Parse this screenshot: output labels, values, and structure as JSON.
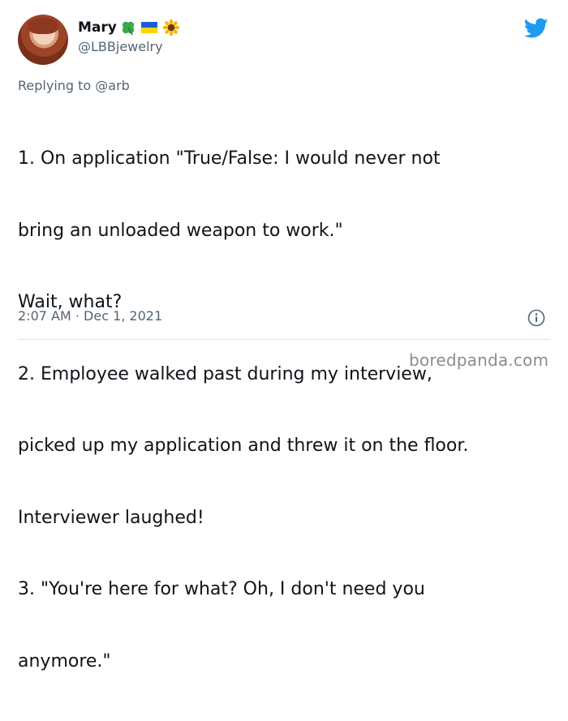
{
  "author": {
    "display_name": "Mary",
    "handle": "@LBBjewelry",
    "name_emojis": [
      "four-leaf-clover",
      "ukraine-flag",
      "sunflower"
    ]
  },
  "reply": {
    "prefix": "Replying to ",
    "mention": "@arb"
  },
  "tweet": {
    "lines": [
      "1. On application \"True/False: I would never not",
      "bring an unloaded weapon to work.\"",
      "Wait, what?",
      "2. Employee walked past during my interview,",
      "picked up my application and threw it on the floor.",
      "Interviewer laughed!",
      "3. \"You're here for what? Oh, I don't need you",
      "anymore.\""
    ],
    "timestamp": "2:07 AM · Dec 1, 2021"
  },
  "watermark": "boredpanda.com",
  "colors": {
    "twitter_blue": "#1d9bf0",
    "secondary_text": "#536471",
    "primary_text": "#0f1419"
  }
}
